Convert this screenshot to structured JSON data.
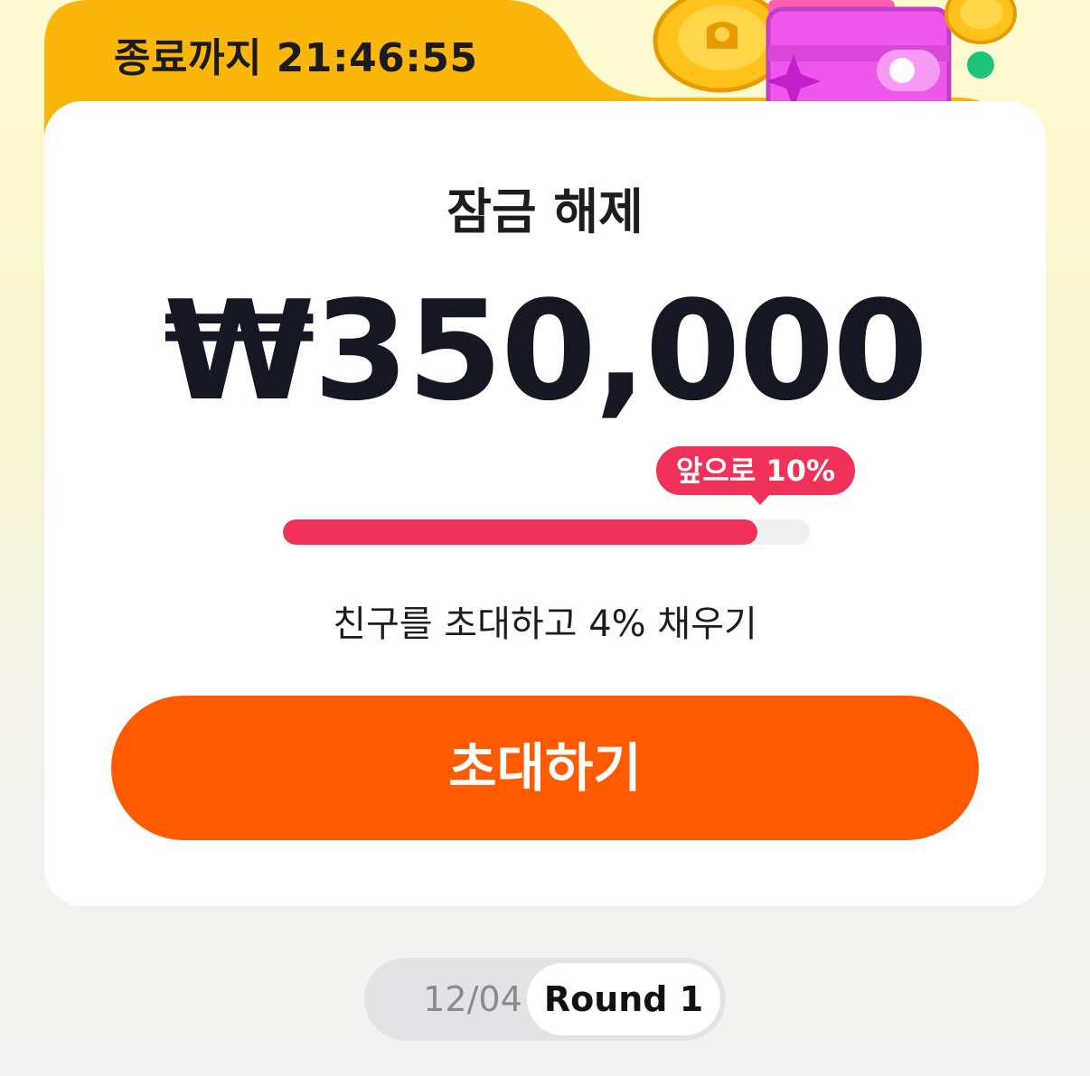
{
  "header": {
    "countdown_text": "종료까지 21:46:55"
  },
  "card": {
    "title": "잠금 해제",
    "amount": "₩350,000",
    "progress": {
      "remaining_label": "앞으로 10%",
      "fill_percent": 90
    },
    "hint": "친구를 초대하고 4% 채우기",
    "invite_button_label": "초대하기"
  },
  "round_selector": {
    "date": "12/04",
    "round": "Round 1"
  },
  "colors": {
    "header_tab": "#fbb60c",
    "progress_fill": "#f0315a",
    "button": "#ff5a00",
    "background_top": "#fffbd0"
  },
  "icons": [
    "coin-icon",
    "wallet-icon",
    "sparkle-icon"
  ]
}
